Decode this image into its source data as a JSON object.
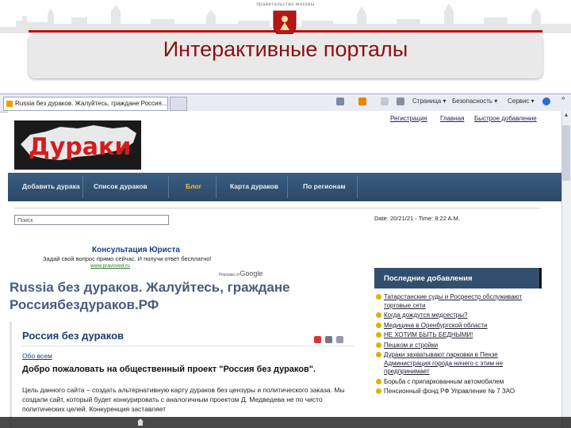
{
  "slide": {
    "government_caption": "правительство москвы",
    "title": "Интерактивные порталы"
  },
  "browser": {
    "tab_title": "Russia без дураков. Жалуйтесь, граждане Россия...",
    "toolbar": {
      "page_label": "Страница",
      "safety_label": "Безопасность",
      "service_label": "Сервис",
      "help_icon": "help-icon",
      "overflow": "»"
    }
  },
  "site": {
    "logo_text": "Дураки",
    "top_links": [
      "Регистрация",
      "Главная",
      "Быстрое добавление"
    ],
    "nav": [
      {
        "label": "Добавить дурака",
        "active": false
      },
      {
        "label": "Список дураков",
        "active": false
      },
      {
        "label": "Блог",
        "active": true
      },
      {
        "label": "Карта дураков",
        "active": false
      },
      {
        "label": "По регионам",
        "active": false
      }
    ],
    "search_placeholder": "Поиск",
    "datetime": "Date: 20/21/21 - Time: 8:22 A.M.",
    "ad": {
      "title": "Консультация Юриста",
      "text": "Задай свой вопрос прямо сейчас. И получи ответ бесплатно!",
      "link": "www.pravoved.ru",
      "adsense_label": "Реклама от",
      "adsense_brand": "Google"
    },
    "post_title": "Russia без дураков. Жалуйтесь, граждане Россиябездураков.РФ",
    "article": {
      "heading": "Россия без дураков",
      "category": "Обо всем",
      "headline": "Добро пожаловать на общественный проект \"Россия без дураков\".",
      "body": "Цель данного сайта – создать альтернативную карту дураков без цензуры и политического заказа. Мы создали сайт, который будет конкурировать с аналогичным проектом Д. Медведева не по чисто политических целей. Конкуренция заставляет"
    },
    "sidebar": {
      "heading": "Последние добавления",
      "items": [
        {
          "text": "Татарстанские суды и Росреестр обслуживают торговые сети",
          "link": true
        },
        {
          "text": "Когда дождутся медсестры?",
          "link": true
        },
        {
          "text": "Медицина в Оренбургской области",
          "link": true
        },
        {
          "text": "НЕ ХОТИМ БЫТЬ БЕДНЫМИ!",
          "link": true
        },
        {
          "text": "Пешком и стройки",
          "link": true
        },
        {
          "text": "Дураки захватывают парковки в Пензе Администрация города ничего с этим не предпринимает",
          "link": true
        },
        {
          "text": "Борьба с припаркованным автомобилем",
          "link": false
        },
        {
          "text": "Пенсионный фонд РФ Управление № 7 ЗАО",
          "link": false
        }
      ]
    }
  },
  "colors": {
    "title_red": "#8b1010",
    "nav_blue": "#2a4866",
    "nav_active": "#f4c430",
    "logo_red": "#d21d1d"
  }
}
